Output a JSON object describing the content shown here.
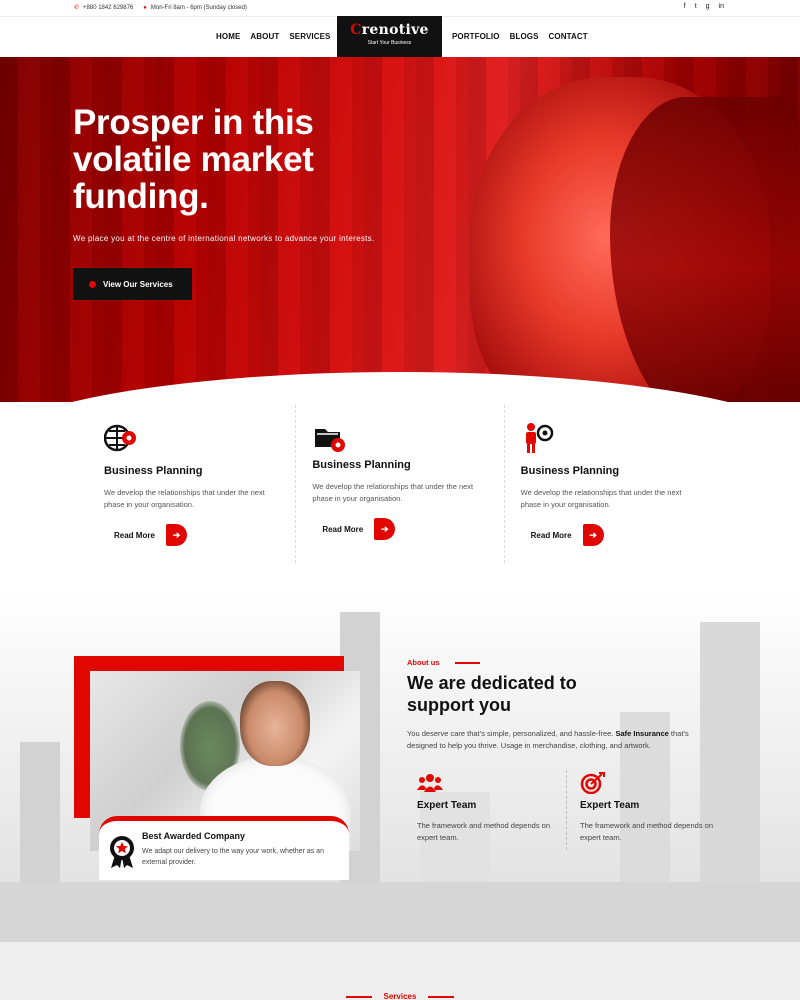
{
  "topbar": {
    "phone": "+880 1842 629876",
    "hours": "Mon-Fri 8am - 6pm (Sunday closed)",
    "social": [
      "f",
      "t",
      "g",
      "in"
    ]
  },
  "nav": {
    "left": [
      "HOME",
      "ABOUT",
      "SERVICES"
    ],
    "right": [
      "PORTFOLIO",
      "BLOGS",
      "CONTACT"
    ]
  },
  "logo": {
    "first": "C",
    "rest": "renotive",
    "tagline": "Start Your Business"
  },
  "hero": {
    "headline": "Prosper in this volatile market funding.",
    "subtext": "We place you at the centre of international networks to advance your interests.",
    "button": "View Our Services"
  },
  "features": [
    {
      "icon": "globe-gear-icon",
      "title": "Business Planning",
      "desc": "We develop the relationships that under the next phase in your organisation.",
      "more": "Read More"
    },
    {
      "icon": "folder-gear-icon",
      "title": "Business Planning",
      "desc": "We develop the relationships that under the next phase in your organisation.",
      "more": "Read More"
    },
    {
      "icon": "person-gear-icon",
      "title": "Business Planning",
      "desc": "We develop the relationships that under the next phase in your organisation.",
      "more": "Read More"
    }
  ],
  "about": {
    "kicker": "About us",
    "heading": "We are dedicated to support you",
    "para_before": "You deserve care that’s simple, personalized, and hassle-free. ",
    "para_bold": "Safe Insurance",
    "para_after": " that’s designed to help you thrive. Usage in merchandise, clothing, and artwork.",
    "award_title": "Best Awarded Company",
    "award_desc": "We adapt our delivery to the way your work, whether as an external provider.",
    "teams": [
      {
        "icon": "team-icon",
        "title": "Expert Team",
        "desc": "The framework and method depends on expert team."
      },
      {
        "icon": "target-icon",
        "title": "Expert Team",
        "desc": "The framework and method depends on expert team."
      }
    ]
  },
  "services": {
    "label": "Services"
  },
  "colors": {
    "accent": "#e10600",
    "dark": "#111111"
  }
}
